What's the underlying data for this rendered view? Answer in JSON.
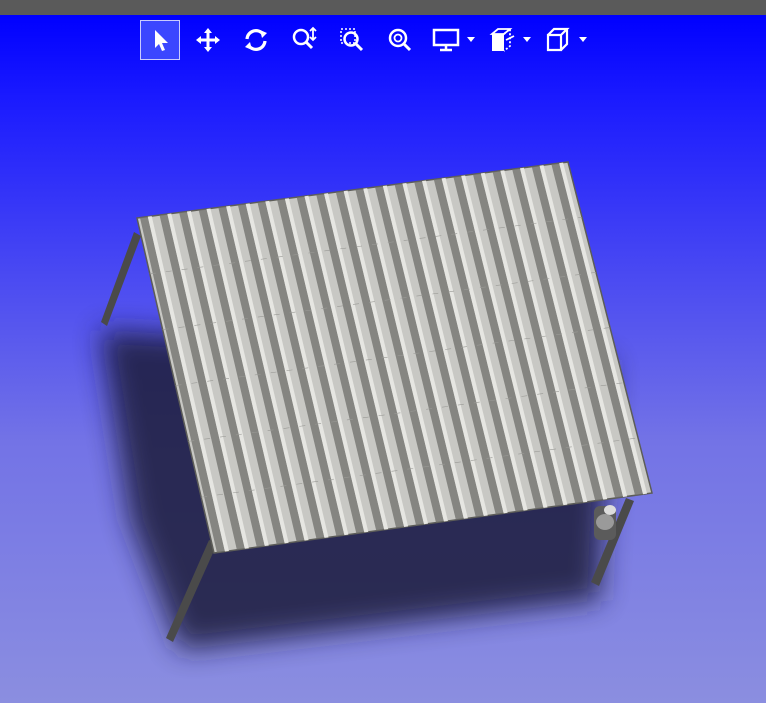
{
  "window": {
    "title_bar_color": "#5a5a5a"
  },
  "viewport": {
    "background_top": "#0000ff",
    "background_bottom": "#8b8ee0"
  },
  "toolbar": {
    "buttons": [
      {
        "id": "select",
        "icon": "arrow-cursor-icon",
        "active": true
      },
      {
        "id": "pan",
        "icon": "move-arrows-icon",
        "active": false
      },
      {
        "id": "rotate",
        "icon": "rotate-icon",
        "active": false
      },
      {
        "id": "zoom-in-out",
        "icon": "zoom-in-out-icon",
        "active": false
      },
      {
        "id": "zoom-to-area",
        "icon": "zoom-area-icon",
        "active": false
      },
      {
        "id": "zoom-to-fit",
        "icon": "zoom-fit-icon",
        "active": false
      },
      {
        "id": "display-style",
        "icon": "monitor-icon",
        "dropdown": true
      },
      {
        "id": "section-view",
        "icon": "section-view-icon",
        "dropdown": true
      },
      {
        "id": "view-orientation",
        "icon": "cube-icon",
        "dropdown": true
      }
    ]
  },
  "model": {
    "description_icon": "canopy-3d-model",
    "roof_color": "#c8c8c4",
    "rib_shadow_color": "#6f6f6b",
    "post_color": "#4a4a4a",
    "shadow_color": "#20203a",
    "rib_count": 22
  }
}
